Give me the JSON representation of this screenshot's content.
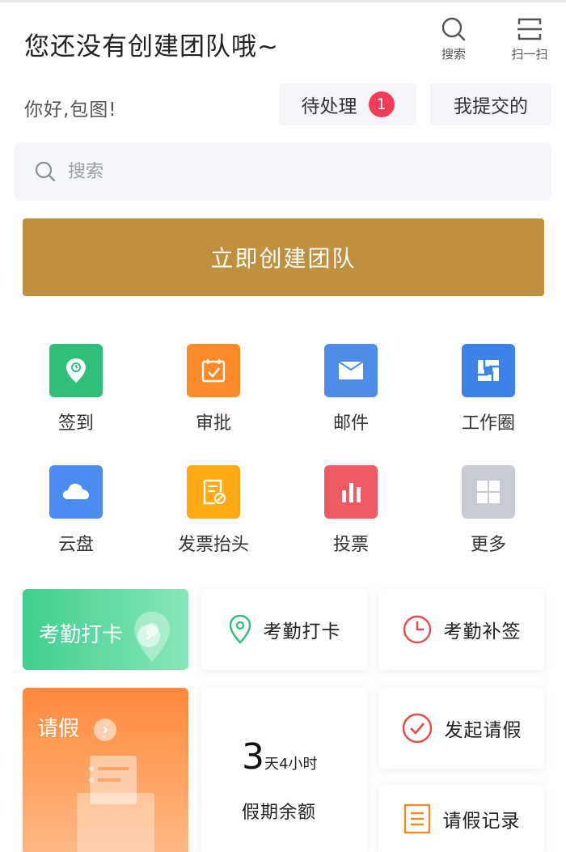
{
  "header": {
    "title": "您还没有创建团队哦~",
    "actions": [
      {
        "label": "搜索",
        "icon": "search-icon"
      },
      {
        "label": "扫一扫",
        "icon": "scan-icon"
      }
    ]
  },
  "greeting": "你好,包图!",
  "pending": {
    "label": "待处理",
    "badge": "1"
  },
  "submitted": {
    "label": "我提交的"
  },
  "search": {
    "placeholder": "搜索"
  },
  "cta": {
    "label": "立即创建团队"
  },
  "grid": [
    {
      "label": "签到",
      "icon": "location-pin-icon",
      "color": "#2fbf7a"
    },
    {
      "label": "审批",
      "icon": "checklist-icon",
      "color": "#ff8a2a"
    },
    {
      "label": "邮件",
      "icon": "mail-icon",
      "color": "#4d8de8"
    },
    {
      "label": "工作圈",
      "icon": "shutter-icon",
      "color": "#3d82e6"
    },
    {
      "label": "云盘",
      "icon": "cloud-icon",
      "color": "#4a8cf0"
    },
    {
      "label": "发票抬头",
      "icon": "invoice-icon",
      "color": "#ffaa14"
    },
    {
      "label": "投票",
      "icon": "bar-chart-icon",
      "color": "#f05a62"
    },
    {
      "label": "更多",
      "icon": "grid-icon",
      "color": "#c8ccd2"
    }
  ],
  "attendance": {
    "banner": "考勤打卡",
    "punch": "考勤打卡",
    "makeup": "考勤补签"
  },
  "leave": {
    "banner": "请假",
    "balance_days": "3",
    "balance_rest": "天4小时",
    "balance_label": "假期余额",
    "start": "发起请假",
    "records": "请假记录"
  },
  "colors": {
    "accent": "#c0903f",
    "badge": "#f23c5a",
    "green": "#2fbf7a",
    "red": "#e84a4a",
    "orange": "#f08a2a"
  }
}
